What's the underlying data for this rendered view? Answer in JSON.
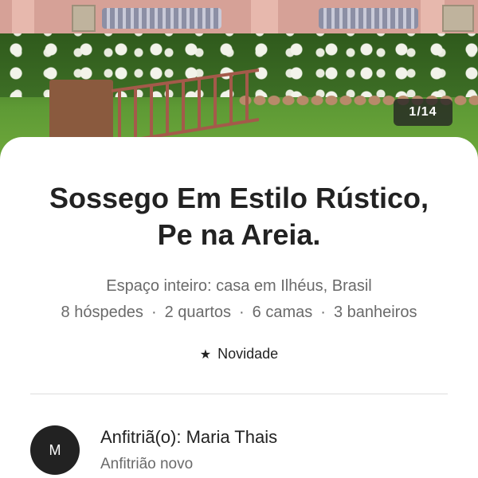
{
  "photo": {
    "counter": "1/14"
  },
  "listing": {
    "title_line1": "Sossego Em Estilo Rústico,",
    "title_line2": "Pe na Areia.",
    "subtitle": "Espaço inteiro: casa em Ilhéus, Brasil",
    "specs": [
      "8 hóspedes",
      "2 quartos",
      "6 camas",
      "3 banheiros"
    ],
    "separator": "·",
    "badge": "Novidade"
  },
  "host": {
    "initial": "M",
    "name": "Anfitriã(o): Maria Thais",
    "status": "Anfitrião novo"
  },
  "icons": {
    "star": "star-icon"
  },
  "colors": {
    "text_primary": "#222222",
    "text_secondary": "#6a6a6a",
    "divider": "#dddddd"
  }
}
